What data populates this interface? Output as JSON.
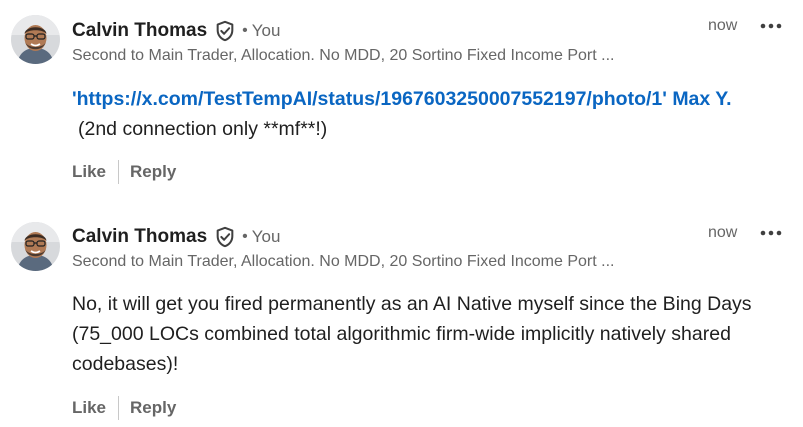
{
  "comments": [
    {
      "author_name": "Calvin Thomas",
      "verified_icon": "shield-check-icon",
      "separator": "•",
      "degree": "You",
      "headline": "Second to Main Trader, Allocation. No MDD, 20 Sortino Fixed Income Port ...",
      "time": "now",
      "more_icon": "ellipsis-icon",
      "body": {
        "quote_open": "'",
        "link_text": "https://x.com/TestTempAI/status/1967603250007552197/photo/1",
        "quote_close": "'",
        "mention": "Max Y.",
        "trailing_text": "(2nd connection only **mf**!)"
      },
      "actions": {
        "like_label": "Like",
        "reply_label": "Reply"
      }
    },
    {
      "author_name": "Calvin Thomas",
      "verified_icon": "shield-check-icon",
      "separator": "•",
      "degree": "You",
      "headline": "Second to Main Trader, Allocation. No MDD, 20 Sortino Fixed Income Port ...",
      "time": "now",
      "more_icon": "ellipsis-icon",
      "body": {
        "text": "No, it will get you fired permanently as an AI Native myself since the Bing Days (75_000 LOCs combined total algorithmic firm-wide implicitly natively shared codebases)!"
      },
      "actions": {
        "like_label": "Like",
        "reply_label": "Reply"
      }
    }
  ],
  "colors": {
    "link": "#0a66c2",
    "meta_text": "#666666",
    "primary_text": "#1f1f1f"
  }
}
